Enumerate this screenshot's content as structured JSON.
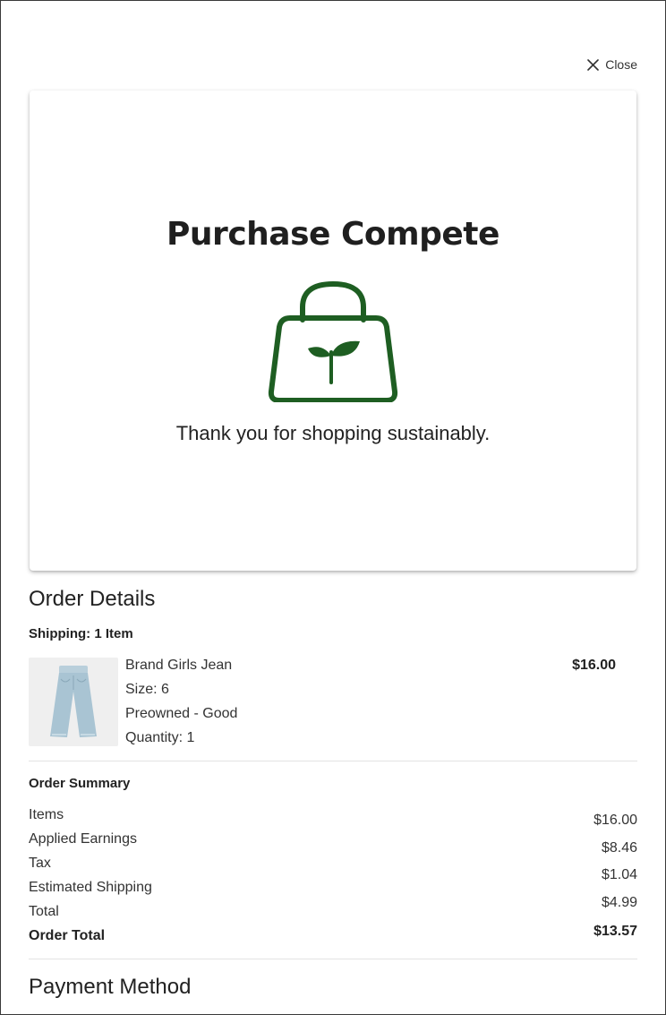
{
  "header": {
    "close_label": "Close"
  },
  "hero": {
    "title": "Purchase Compete",
    "message": "Thank you for shopping sustainably.",
    "icon": "shopping-bag-sprout-icon",
    "accent_color": "#1e5e22"
  },
  "order_details": {
    "title": "Order Details",
    "shipping_label": "Shipping: 1 Item",
    "item": {
      "name": "Brand Girls Jean",
      "size": "Size: 6",
      "condition": "Preowned - Good",
      "quantity": "Quantity: 1",
      "price": "$16.00"
    }
  },
  "order_summary": {
    "title": "Order Summary",
    "labels": [
      "Items",
      "Applied Earnings",
      "Tax",
      "Estimated Shipping",
      "Total",
      "Order Total"
    ],
    "values": [
      "$16.00",
      "$8.46",
      "$1.04",
      "$4.99",
      "$13.57"
    ]
  },
  "payment": {
    "title": "Payment Method"
  }
}
